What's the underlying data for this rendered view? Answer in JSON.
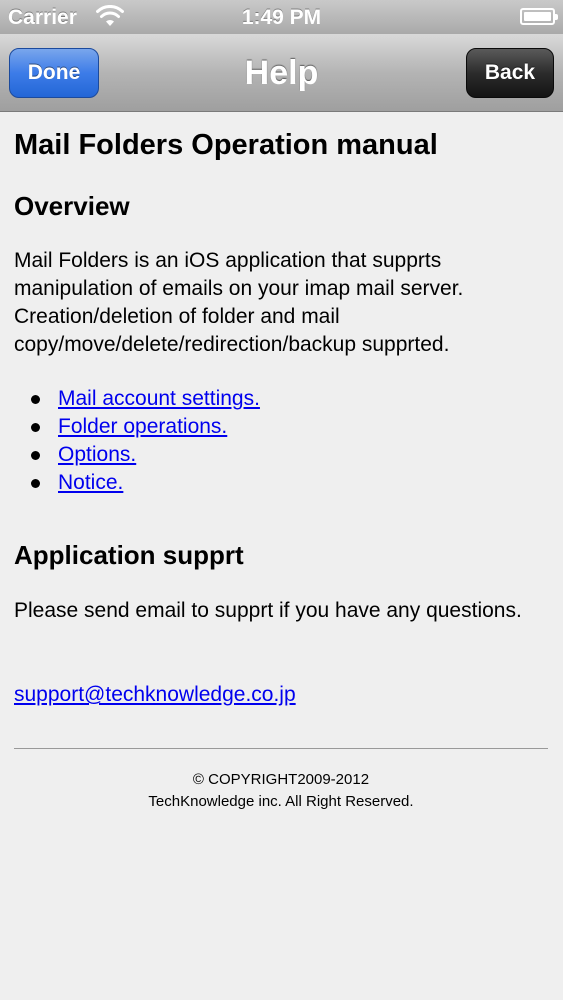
{
  "status_bar": {
    "carrier": "Carrier",
    "time": "1:49 PM",
    "wifi_icon": "wifi-icon",
    "battery_icon": "battery-full-icon"
  },
  "nav": {
    "title": "Help",
    "done_label": "Done",
    "back_label": "Back"
  },
  "content": {
    "title": "Mail Folders Operation manual",
    "overview_heading": "Overview",
    "overview_text": "Mail Folders is an iOS application that supprts manipulation of emails on your imap mail server. Creation/deletion of folder and mail copy/move/delete/redirection/backup supprted.",
    "links": [
      {
        "label": "Mail account settings."
      },
      {
        "label": "Folder operations."
      },
      {
        "label": "Options."
      },
      {
        "label": "Notice."
      }
    ],
    "support_heading": "Application supprt",
    "support_text": "Please send email to supprt if you have any questions.",
    "support_email": "support@techknowledge.co.jp "
  },
  "footer": {
    "copyright": "© COPYRIGHT2009-2012",
    "company": "TechKnowledge inc. All Right Reserved."
  },
  "colors": {
    "link": "#0000ee",
    "done_button": "#2f74e0",
    "back_button": "#222222",
    "background": "#efefef"
  }
}
